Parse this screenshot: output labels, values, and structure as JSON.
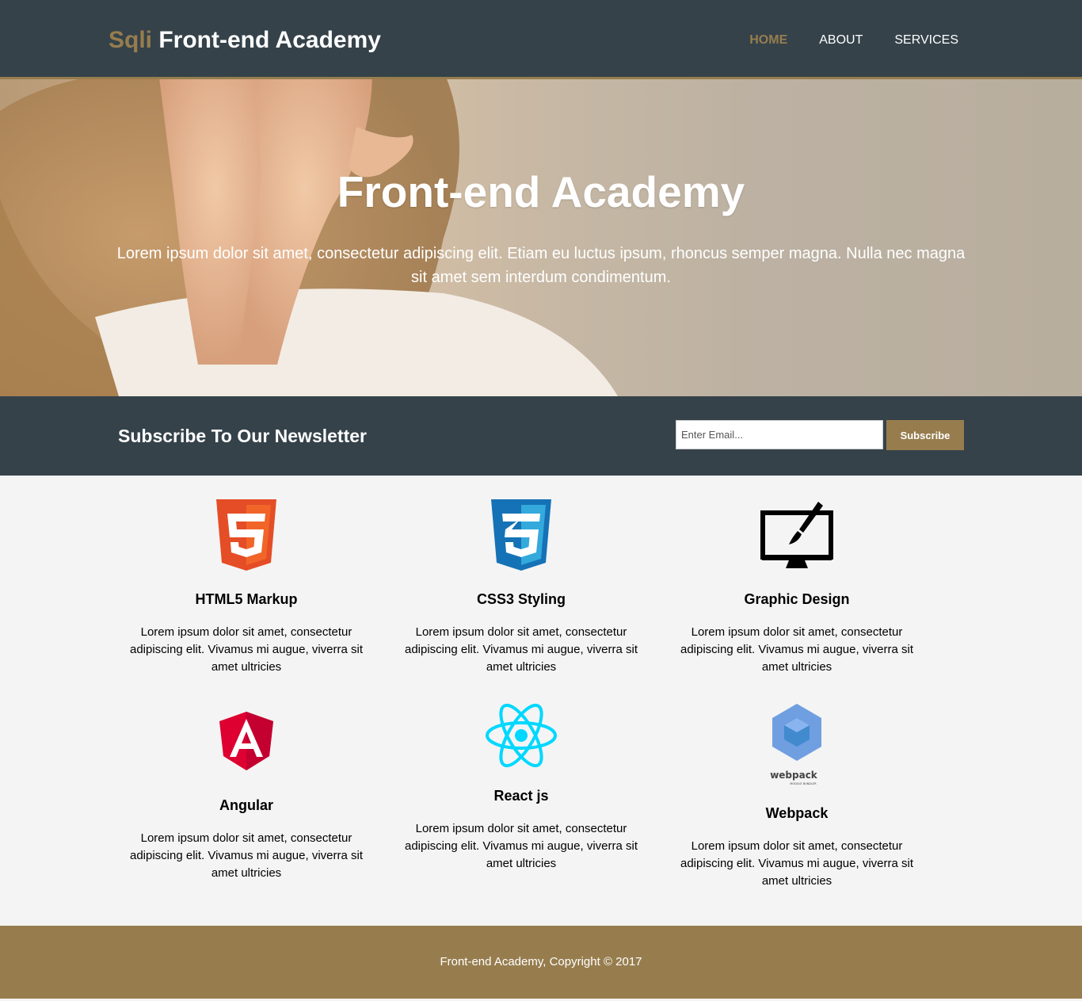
{
  "header": {
    "brand_accent": "Sqli",
    "brand_main": "Front-end Academy",
    "nav": [
      {
        "label": "HOME",
        "active": true
      },
      {
        "label": "ABOUT",
        "active": false
      },
      {
        "label": "SERVICES",
        "active": false
      }
    ]
  },
  "hero": {
    "title": "Front-end Academy",
    "text": "Lorem ipsum dolor sit amet, consectetur adipiscing elit. Etiam eu luctus ipsum, rhoncus semper magna. Nulla nec magna sit amet sem interdum condimentum."
  },
  "newsletter": {
    "heading": "Subscribe To Our Newsletter",
    "email_placeholder": "Enter Email...",
    "button_label": "Subscribe"
  },
  "boxes": [
    {
      "icon": "html5-icon",
      "title": "HTML5 Markup",
      "text": "Lorem ipsum dolor sit amet, consectetur adipiscing elit. Vivamus mi augue, viverra sit amet ultricies"
    },
    {
      "icon": "css3-icon",
      "title": "CSS3 Styling",
      "text": "Lorem ipsum dolor sit amet, consectetur adipiscing elit. Vivamus mi augue, viverra sit amet ultricies"
    },
    {
      "icon": "graphic-design-icon",
      "title": "Graphic Design",
      "text": "Lorem ipsum dolor sit amet, consectetur adipiscing elit. Vivamus mi augue, viverra sit amet ultricies"
    },
    {
      "icon": "angular-icon",
      "title": "Angular",
      "text": "Lorem ipsum dolor sit amet, consectetur adipiscing elit. Vivamus mi augue, viverra sit amet ultricies"
    },
    {
      "icon": "react-icon",
      "title": "React js",
      "text": "Lorem ipsum dolor sit amet, consectetur adipiscing elit. Vivamus mi augue, viverra sit amet ultricies"
    },
    {
      "icon": "webpack-icon",
      "title": "Webpack",
      "text": "Lorem ipsum dolor sit amet, consectetur adipiscing elit. Vivamus mi augue, viverra sit amet ultricies",
      "logo_text": "webpack",
      "logo_subtext": "MODULE BUNDLER"
    }
  ],
  "footer": {
    "text": "Front-end Academy, Copyright © 2017"
  },
  "colors": {
    "header_bg": "#35424a",
    "accent": "#977d4e",
    "page_bg": "#f4f4f4"
  }
}
